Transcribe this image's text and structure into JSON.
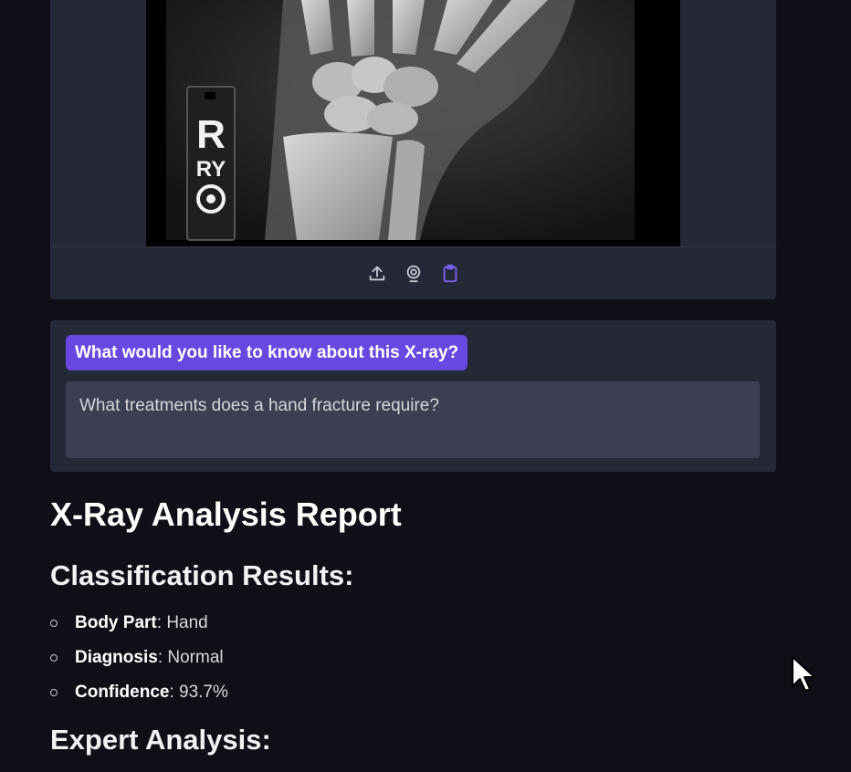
{
  "image_panel": {
    "marker_letters": [
      "R",
      "RY"
    ],
    "toolbar": [
      {
        "icon": "upload-icon",
        "color": "#c9cad2"
      },
      {
        "icon": "webcam-icon",
        "color": "#c9cad2"
      },
      {
        "icon": "clipboard-icon",
        "color": "#7c62f0"
      }
    ]
  },
  "question": {
    "label": "What would you like to know about this X-ray?",
    "value": "What treatments does a hand fracture require?"
  },
  "report": {
    "title": "X-Ray Analysis Report",
    "classification_title": "Classification Results:",
    "results": [
      {
        "key": "Body Part",
        "value": "Hand"
      },
      {
        "key": "Diagnosis",
        "value": "Normal"
      },
      {
        "key": "Confidence",
        "value": "93.7%"
      }
    ],
    "expert_title": "Expert Analysis:"
  },
  "colors": {
    "background": "#0f0f17",
    "panel": "#252836",
    "accent": "#6748e0",
    "input": "#3c3f52"
  }
}
